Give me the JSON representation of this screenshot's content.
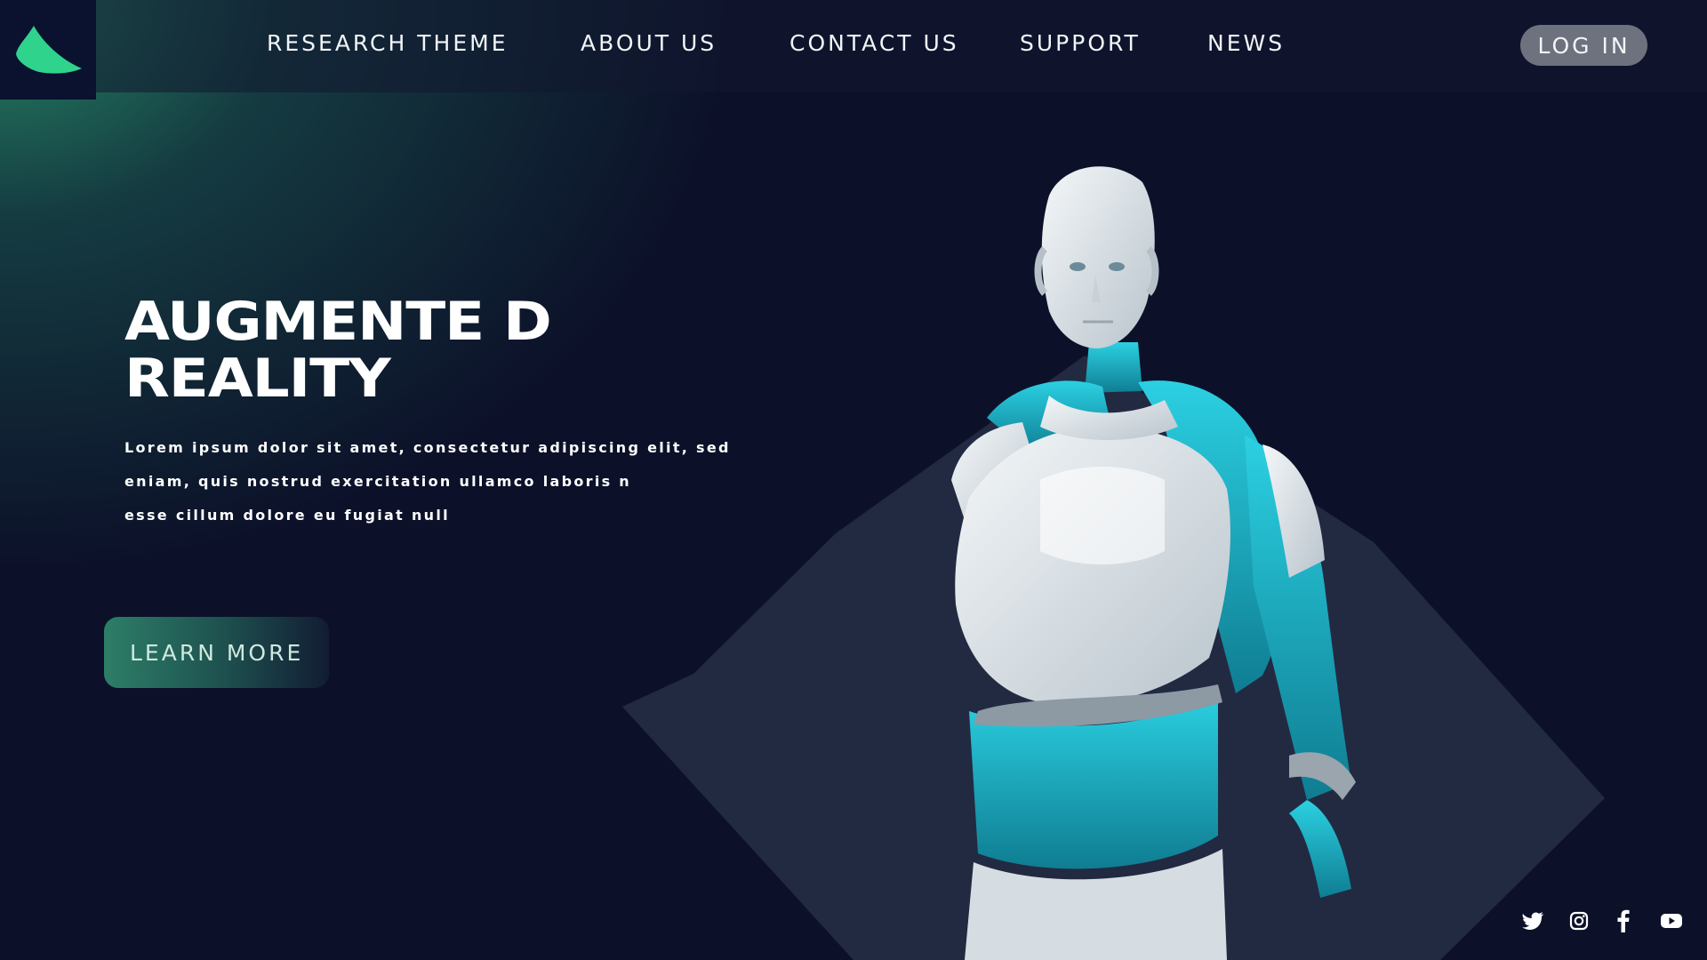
{
  "nav": {
    "items": [
      {
        "label": "RESEARCH THEME"
      },
      {
        "label": "ABOUT US"
      },
      {
        "label": "CONTACT US"
      },
      {
        "label": "SUPPORT"
      },
      {
        "label": "NEWS"
      }
    ],
    "login_label": "LOG IN"
  },
  "hero": {
    "title_line1": "AUGMENTE D",
    "title_line2": "REALITY",
    "description_lines": [
      "Lorem ipsum dolor sit amet, consectetur adipiscing elit, sed",
      "eniam, quis nostrud exercitation ullamco laboris n",
      "esse cillum dolore eu fugiat null"
    ],
    "cta_label": "LEARN MORE"
  },
  "icons": {
    "logo": "leaf-logo-icon",
    "social": [
      "twitter-icon",
      "instagram-icon",
      "facebook-icon",
      "youtube-icon"
    ]
  },
  "colors": {
    "background": "#0c1129",
    "accent_green": "#2fd38c",
    "diamond": "#222a42",
    "login_button": "#6e727f",
    "robot_cyan": "#1fb3c9"
  }
}
